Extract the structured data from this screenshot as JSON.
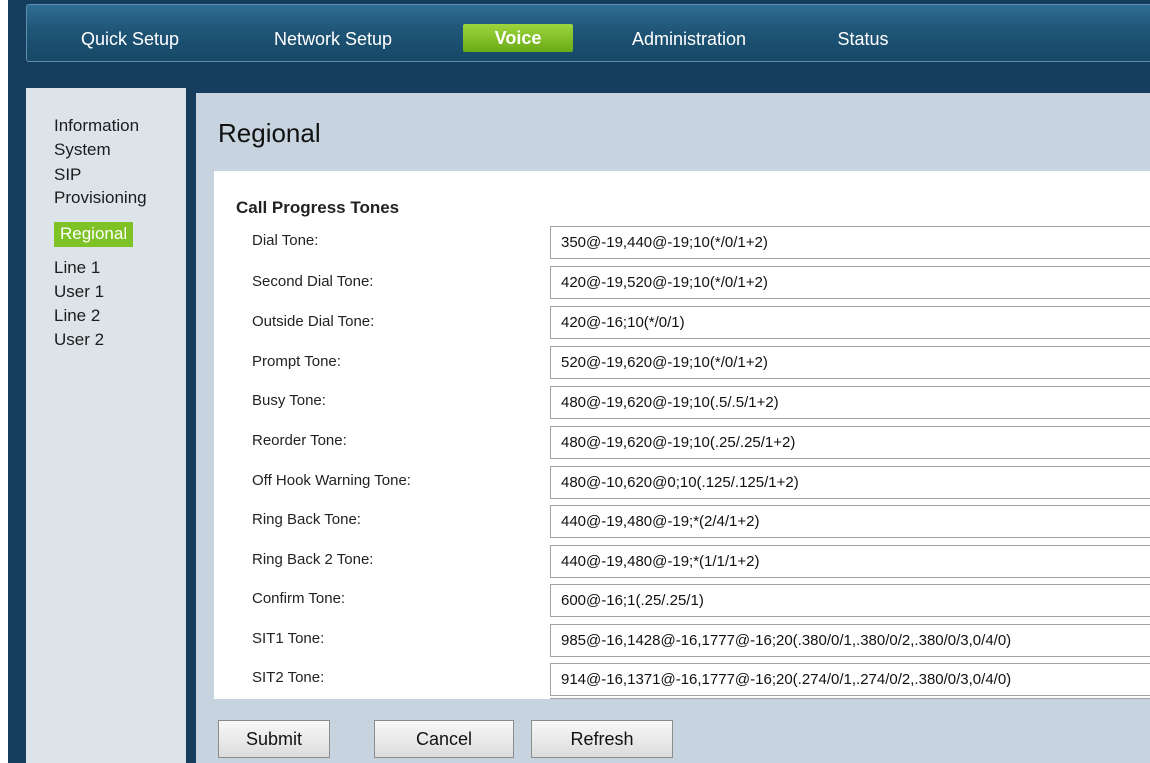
{
  "nav": {
    "items": [
      "Quick Setup",
      "Network Setup",
      "Voice",
      "Administration",
      "Status"
    ],
    "active": "Voice"
  },
  "sidebar": {
    "items": [
      "Information",
      "System",
      "SIP",
      "Provisioning",
      "Regional",
      "Line 1",
      "User 1",
      "Line 2",
      "User 2"
    ],
    "active": "Regional"
  },
  "page": {
    "title": "Regional"
  },
  "section": {
    "title": "Call Progress Tones"
  },
  "fields": [
    {
      "label": "Dial Tone:",
      "value": "350@-19,440@-19;10(*/0/1+2)"
    },
    {
      "label": "Second Dial Tone:",
      "value": "420@-19,520@-19;10(*/0/1+2)"
    },
    {
      "label": "Outside Dial Tone:",
      "value": "420@-16;10(*/0/1)"
    },
    {
      "label": "Prompt Tone:",
      "value": "520@-19,620@-19;10(*/0/1+2)"
    },
    {
      "label": "Busy Tone:",
      "value": "480@-19,620@-19;10(.5/.5/1+2)"
    },
    {
      "label": "Reorder Tone:",
      "value": "480@-19,620@-19;10(.25/.25/1+2)"
    },
    {
      "label": "Off Hook Warning Tone:",
      "value": "480@-10,620@0;10(.125/.125/1+2)"
    },
    {
      "label": "Ring Back Tone:",
      "value": "440@-19,480@-19;*(2/4/1+2)"
    },
    {
      "label": "Ring Back 2 Tone:",
      "value": "440@-19,480@-19;*(1/1/1+2)"
    },
    {
      "label": "Confirm Tone:",
      "value": "600@-16;1(.25/.25/1)"
    },
    {
      "label": "SIT1 Tone:",
      "value": "985@-16,1428@-16,1777@-16;20(.380/0/1,.380/0/2,.380/0/3,0/4/0)"
    },
    {
      "label": "SIT2 Tone:",
      "value": "914@-16,1371@-16,1777@-16;20(.274/0/1,.274/0/2,.380/0/3,0/4/0)"
    }
  ],
  "buttons": {
    "submit": "Submit",
    "cancel": "Cancel",
    "refresh": "Refresh"
  }
}
